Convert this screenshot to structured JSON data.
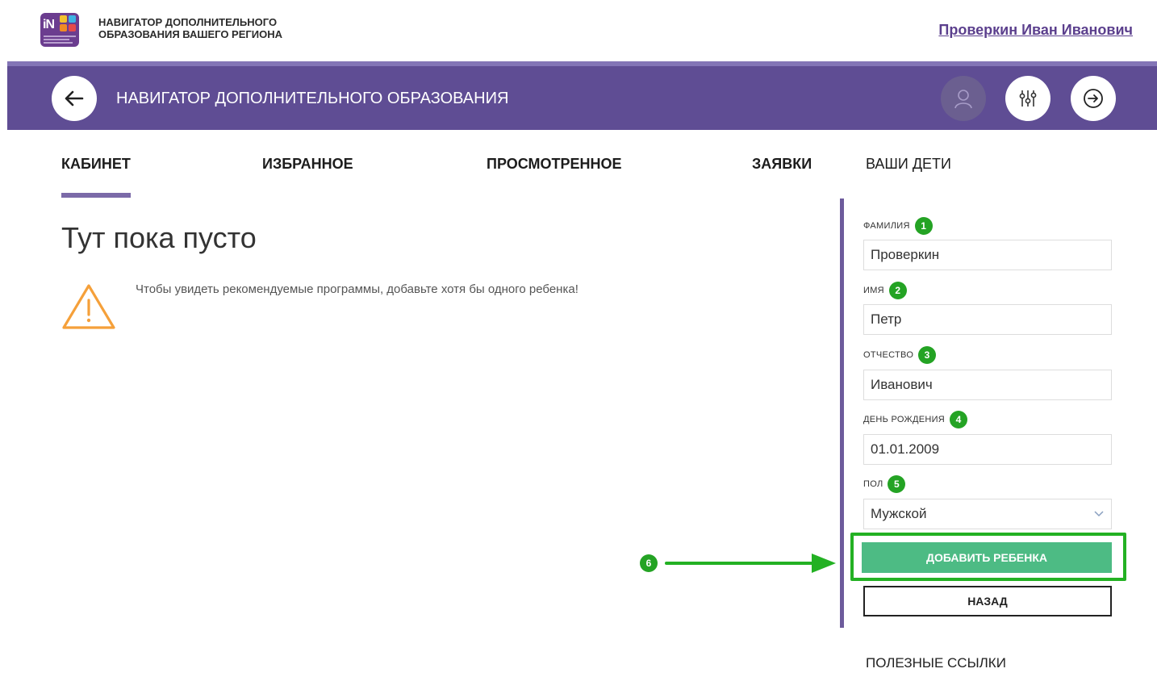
{
  "header": {
    "site_title": "НАВИГАТОР ДОПОЛНИТЕЛЬНОГО ОБРАЗОВАНИЯ ВАШЕГО РЕГИОНА",
    "logo_text": "iN",
    "user_name": "Проверкин Иван Иванович"
  },
  "navbar": {
    "title": "НАВИГАТОР ДОПОЛНИТЕЛЬНОГО ОБРАЗОВАНИЯ",
    "back_icon": "arrow-left-icon",
    "avatar_icon": "user-icon",
    "filter_icon": "sliders-icon",
    "logout_icon": "arrow-right-circle-icon"
  },
  "tabs": [
    {
      "label": "КАБИНЕТ",
      "active": true
    },
    {
      "label": "ИЗБРАННОЕ",
      "active": false
    },
    {
      "label": "ПРОСМОТРЕННОЕ",
      "active": false
    },
    {
      "label": "ЗАЯВКИ",
      "active": false
    },
    {
      "label": "ВАШИ ДЕТИ",
      "active": false
    }
  ],
  "main": {
    "empty_title": "Тут пока пусто",
    "warning_text": "Чтобы увидеть рекомендуемые программы, добавьте хотя бы одного ребенка!"
  },
  "form": {
    "fields": [
      {
        "label": "ФАМИЛИЯ",
        "badge": "1",
        "value": "Проверкин"
      },
      {
        "label": "ИМЯ",
        "badge": "2",
        "value": "Петр"
      },
      {
        "label": "ОТЧЕСТВО",
        "badge": "3",
        "value": "Иванович"
      },
      {
        "label": "ДЕНЬ РОЖДЕНИЯ",
        "badge": "4",
        "value": "01.01.2009"
      },
      {
        "label": "ПОЛ",
        "badge": "5",
        "value": "Мужской"
      }
    ],
    "add_button": "ДОБАВИТЬ РЕБЕНКА",
    "back_button": "НАЗАД",
    "callout_badge": "6"
  },
  "footer": {
    "useful_links": "ПОЛЕЗНЫЕ ССЫЛКИ"
  },
  "colors": {
    "nav_purple": "#5f4d94",
    "accent_purple": "#7b6aa8",
    "green_button": "#4dbb84",
    "annotation_green": "#23b123",
    "warning_orange": "#f5a03a"
  }
}
